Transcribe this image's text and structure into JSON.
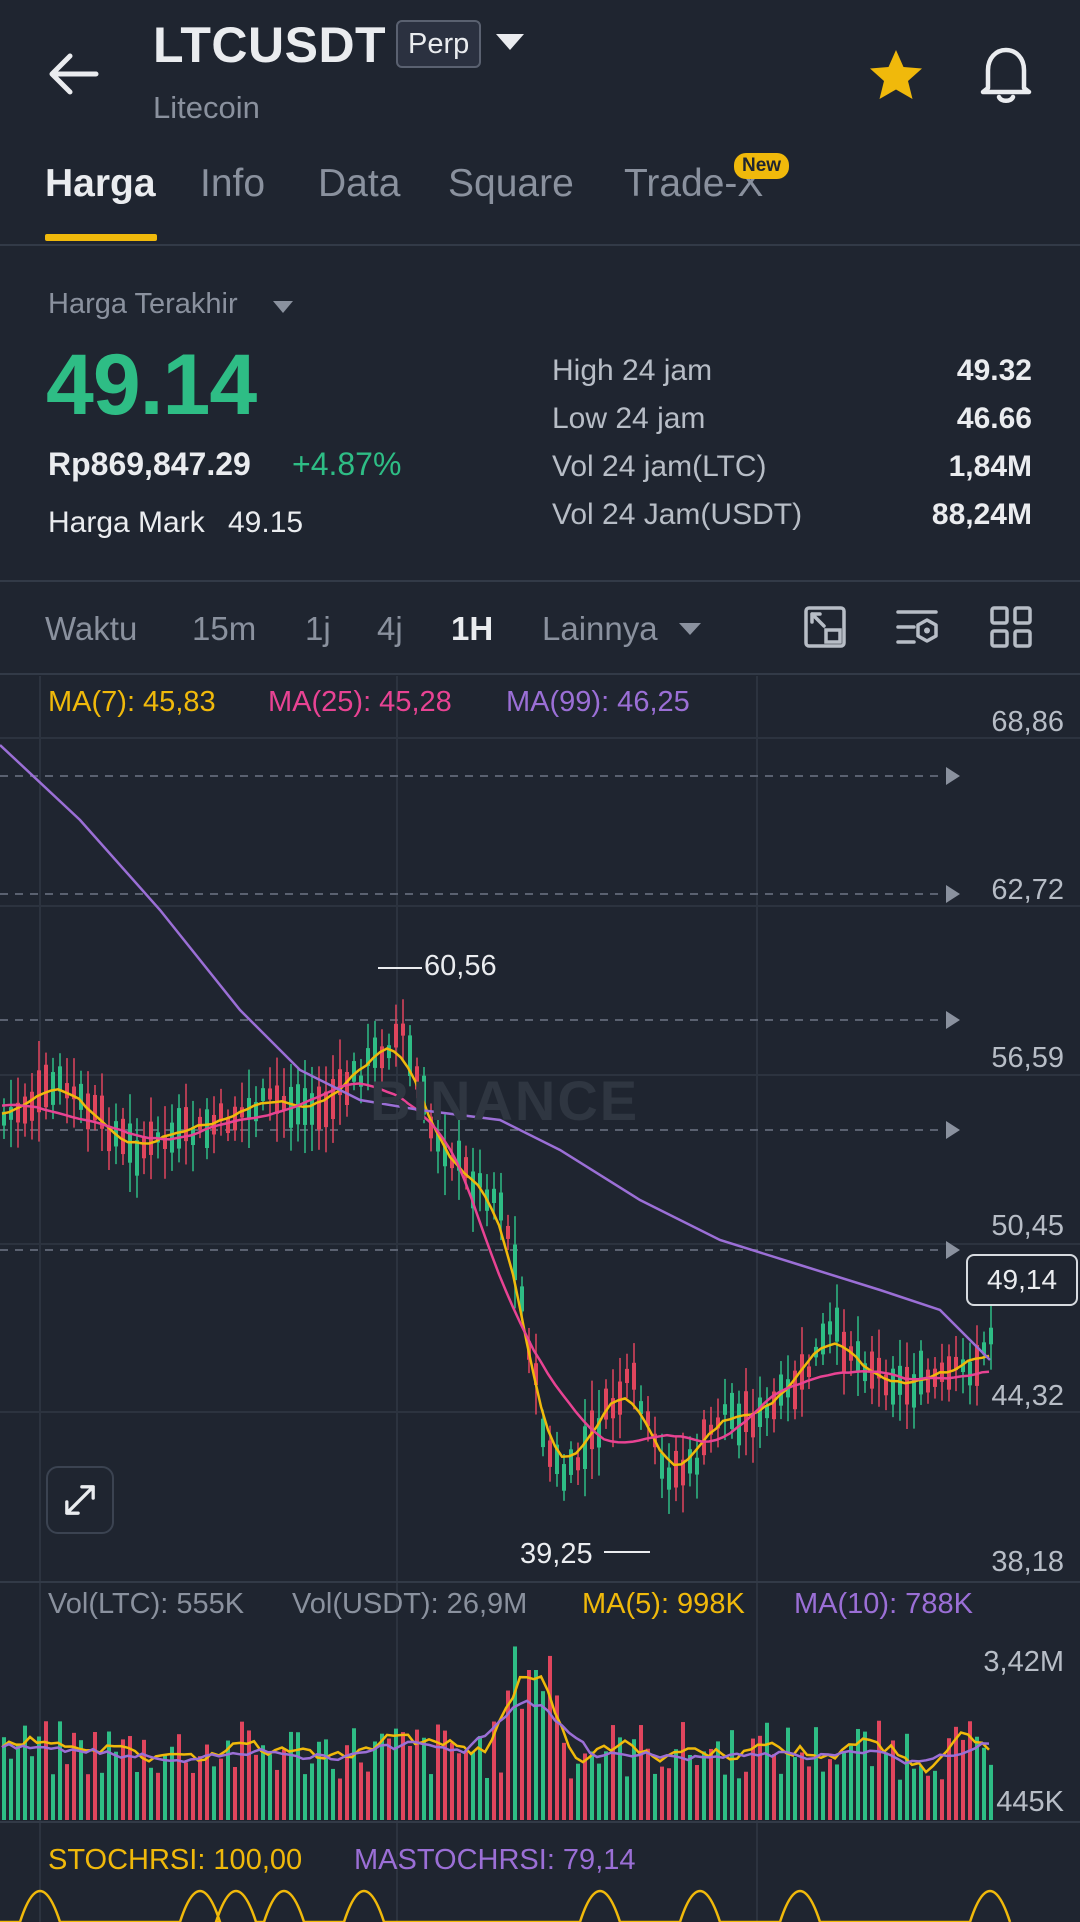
{
  "header": {
    "symbol": "LTCUSDT",
    "contract_type": "Perp",
    "coin_name": "Litecoin"
  },
  "tabs": [
    {
      "label": "Harga",
      "active": true
    },
    {
      "label": "Info",
      "active": false
    },
    {
      "label": "Data",
      "active": false
    },
    {
      "label": "Square",
      "active": false
    },
    {
      "label": "Trade-X",
      "active": false,
      "badge": "New"
    }
  ],
  "price": {
    "label": "Harga Terakhir",
    "last": "49.14",
    "idr": "Rp869,847.29",
    "change_pct": "+4.87%",
    "mark_label": "Harga Mark",
    "mark_value": "49.15"
  },
  "stats": [
    {
      "label": "High 24 jam",
      "value": "49.32"
    },
    {
      "label": "Low 24 jam",
      "value": "46.66"
    },
    {
      "label": "Vol 24 jam(LTC)",
      "value": "1,84M"
    },
    {
      "label": "Vol 24 Jam(USDT)",
      "value": "88,24M"
    }
  ],
  "timeframes": [
    {
      "label": "Waktu",
      "active": false
    },
    {
      "label": "15m",
      "active": false
    },
    {
      "label": "1j",
      "active": false
    },
    {
      "label": "4j",
      "active": false
    },
    {
      "label": "1H",
      "active": true
    },
    {
      "label": "Lainnya",
      "active": false
    }
  ],
  "toolbar_icons": [
    "chart-settings-icon",
    "indicator-icon",
    "layout-grid-icon"
  ],
  "ma_legend": [
    {
      "text": "MA(7): 45,83",
      "color": "#f0b90b"
    },
    {
      "text": "MA(25): 45,28",
      "color": "#e84393"
    },
    {
      "text": "MA(99): 46,25",
      "color": "#9b6fd6"
    }
  ],
  "y_axis": [
    "68,86",
    "62,72",
    "56,59",
    "50,45",
    "44,32",
    "38,18"
  ],
  "current_price_tag": "49,14",
  "high_marker": "60,56",
  "low_marker": "39,25",
  "watermark": "BINANCE",
  "volume_legend": [
    {
      "text": "Vol(LTC): 555K",
      "color": "#8a919e"
    },
    {
      "text": "Vol(USDT): 26,9M",
      "color": "#8a919e"
    },
    {
      "text": "MA(5): 998K",
      "color": "#f0b90b"
    },
    {
      "text": "MA(10): 788K",
      "color": "#9b6fd6"
    }
  ],
  "volume_axis": [
    "3,42M",
    "445K"
  ],
  "stoch_legend": [
    {
      "text": "STOCHRSI: 100,00",
      "color": "#f0b90b"
    },
    {
      "text": "MASTOCHRSI: 79,14",
      "color": "#9b6fd6"
    }
  ],
  "colors": {
    "up": "#2ebd85",
    "down": "#e0455d",
    "accent": "#f0b90b",
    "background": "#1f2530"
  }
}
